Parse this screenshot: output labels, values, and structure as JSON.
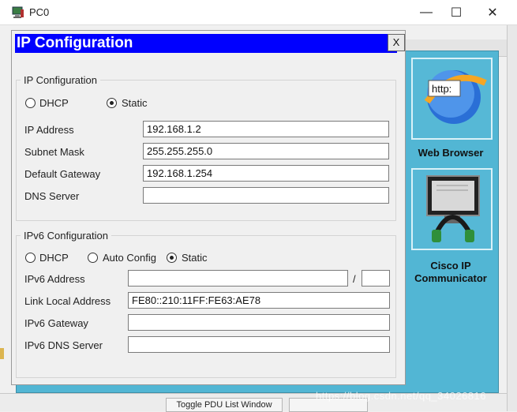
{
  "window": {
    "title": "PC0",
    "minimize_glyph": "—",
    "maximize_glyph": "☐",
    "close_glyph": "✕",
    "icon": "pc-icon"
  },
  "dialog": {
    "title": "IP Configuration",
    "close_label": "X"
  },
  "ipv4": {
    "legend": "IP Configuration",
    "dhcp_label": "DHCP",
    "static_label": "Static",
    "mode": "static",
    "ip_label": "IP Address",
    "ip_value": "192.168.1.2",
    "mask_label": "Subnet Mask",
    "mask_value": "255.255.255.0",
    "gateway_label": "Default Gateway",
    "gateway_value": "192.168.1.254",
    "dns_label": "DNS Server",
    "dns_value": ""
  },
  "ipv6": {
    "legend": "IPv6 Configuration",
    "dhcp_label": "DHCP",
    "auto_label": "Auto Config",
    "static_label": "Static",
    "mode": "static",
    "address_label": "IPv6 Address",
    "address_value": "",
    "prefix_separator": "/",
    "prefix_value": "",
    "link_local_label": "Link Local Address",
    "link_local_value": "FE80::210:11FF:FE63:AE78",
    "gateway_label": "IPv6 Gateway",
    "gateway_value": "",
    "dns_label": "IPv6 DNS Server",
    "dns_value": ""
  },
  "apps": [
    {
      "label": "Web Browser",
      "icon": "web-browser-icon",
      "icon_text": "http:"
    },
    {
      "label_line1": "Cisco IP",
      "label_line2": "Communicator",
      "icon": "cisco-ip-communicator-icon"
    }
  ],
  "bottom_bar": {
    "button_label": "Toggle PDU List Window"
  },
  "watermark": "https://blog.csdn.net/qq_34026816",
  "colors": {
    "dialog_title_bg": "#0000ff",
    "panel_bg": "#52b6d4"
  }
}
